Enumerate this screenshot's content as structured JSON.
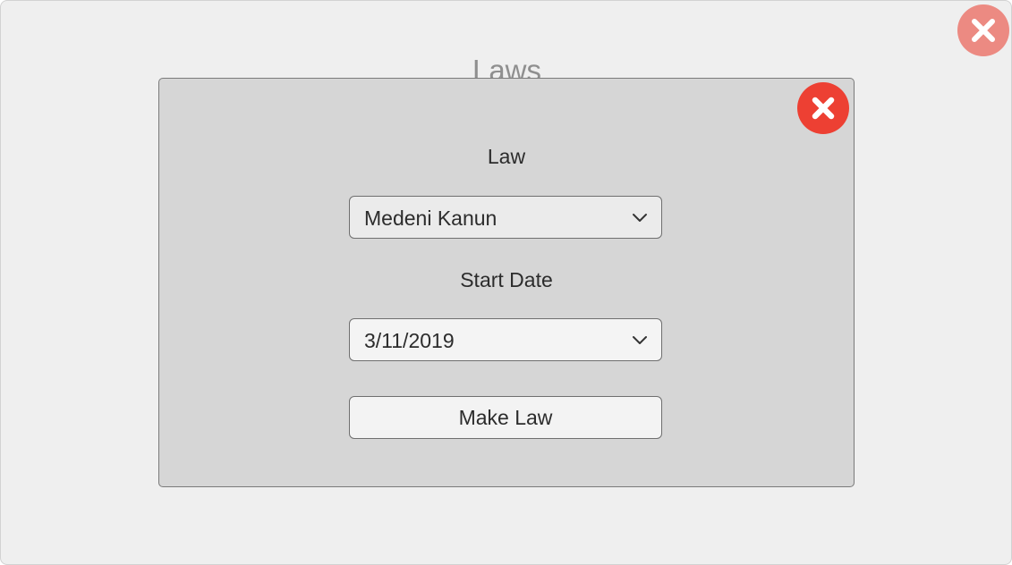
{
  "background": {
    "title": "Laws",
    "close_icon": "close-icon"
  },
  "dialog": {
    "close_icon": "close-icon",
    "law_label": "Law",
    "law_select": {
      "value": "Medeni Kanun",
      "icon": "chevron-down-icon"
    },
    "start_date_label": "Start Date",
    "date_select": {
      "value": "3/11/2019",
      "icon": "chevron-down-icon"
    },
    "make_law_label": "Make Law"
  },
  "colors": {
    "close_accent": "#ed4033",
    "close_faded": "#ec8a82",
    "dialog_bg": "#d6d6d6",
    "screen_bg": "#efefef"
  }
}
